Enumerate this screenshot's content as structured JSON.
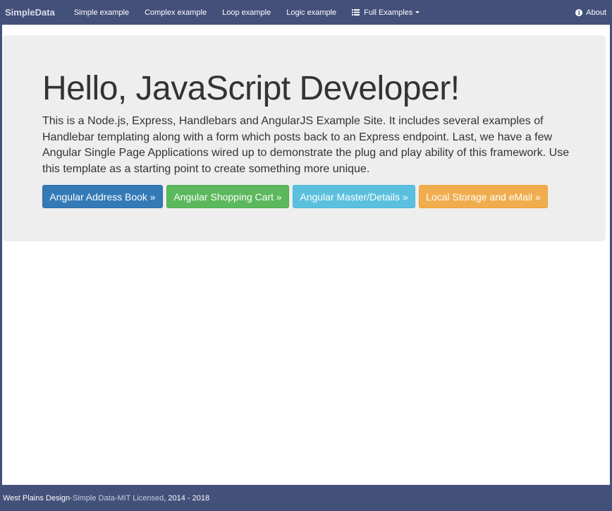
{
  "navbar": {
    "brand": "SimpleData",
    "items": [
      {
        "label": "Simple example"
      },
      {
        "label": "Complex example"
      },
      {
        "label": "Loop example"
      },
      {
        "label": "Logic example"
      }
    ],
    "full_examples": {
      "label": "Full Examples",
      "icon": "list-icon"
    },
    "about": {
      "label": "About",
      "icon": "info-icon"
    }
  },
  "jumbotron": {
    "title": "Hello, JavaScript Developer!",
    "lead": "This is a Node.js, Express, Handlebars and AngularJS Example Site. It includes several examples of Handlebar templating along with a form which posts back to an Express endpoint. Last, we have a few Angular Single Page Applications wired up to demonstrate the plug and play ability of this framework. Use this template as a starting point to create something more unique.",
    "buttons": [
      {
        "label": "Angular Address Book »",
        "color": "#337ab7"
      },
      {
        "label": "Angular Shopping Cart »",
        "color": "#5cb85c"
      },
      {
        "label": "Angular Master/Details »",
        "color": "#5bc0de"
      },
      {
        "label": "Local Storage and eMail »",
        "color": "#f0ad4e"
      }
    ]
  },
  "footer": {
    "company": "West Plains Design",
    "sep1": " - ",
    "product": "Simple Data",
    "sep2": " - ",
    "license": "MIT Licensed",
    "years": ", 2014 - 2018"
  },
  "colors": {
    "navbar": "#435079",
    "jumbotron": "#eeeeee"
  }
}
